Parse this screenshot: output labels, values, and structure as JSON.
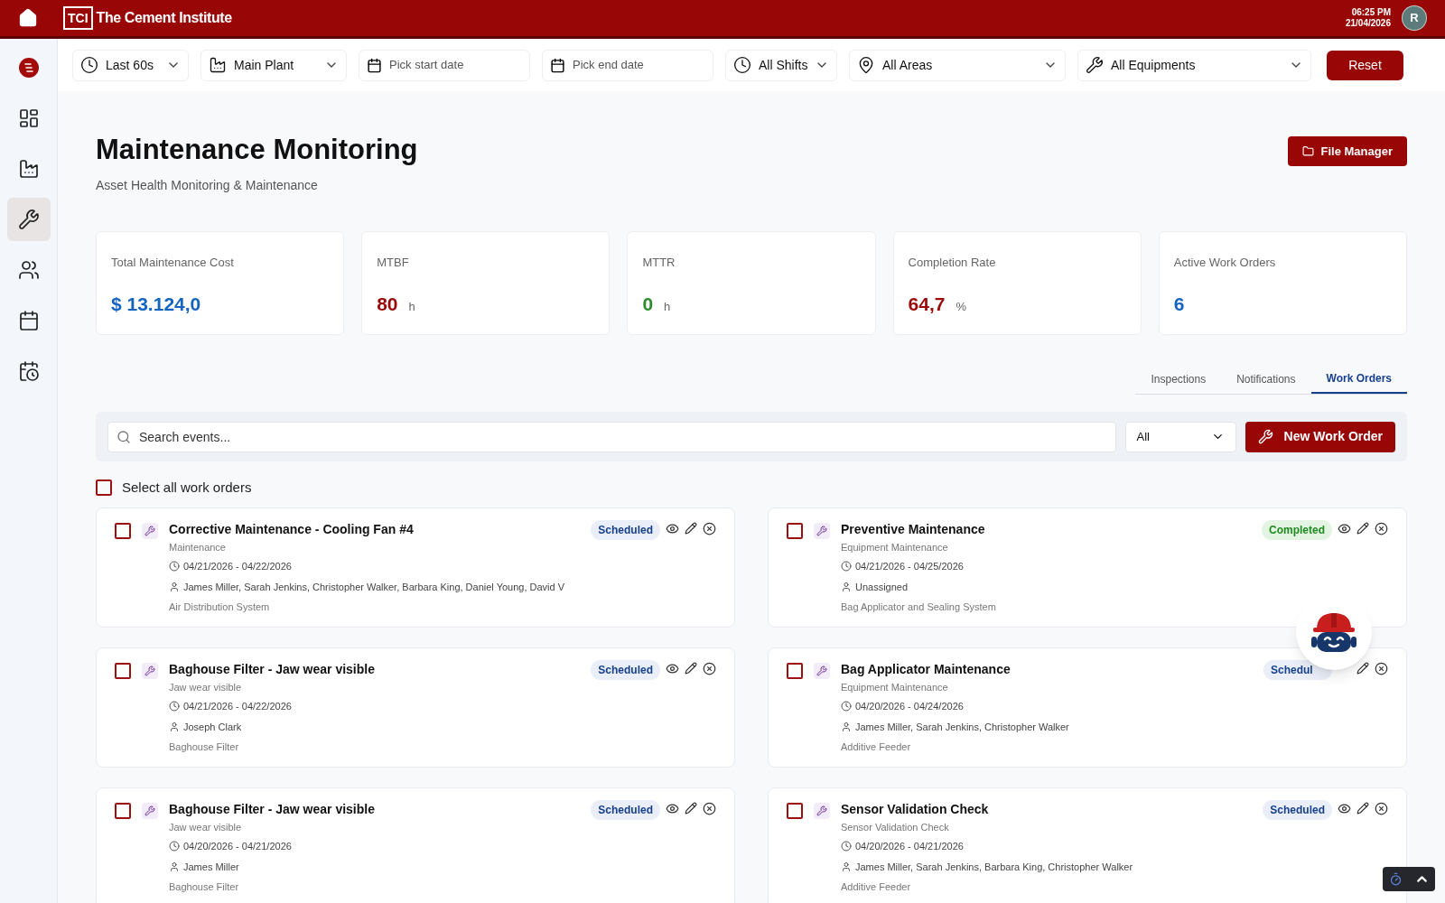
{
  "header": {
    "logo_mark": "TCI",
    "brand": "The Cement Institute",
    "time": "06:25 PM",
    "date": "21/04/2026",
    "avatar": "R"
  },
  "sidebar": {
    "items": [
      {
        "kind": "logo",
        "selected": false
      },
      {
        "kind": "dashboard",
        "selected": false
      },
      {
        "kind": "factory",
        "selected": false
      },
      {
        "kind": "wrench",
        "selected": true
      },
      {
        "kind": "users",
        "selected": false
      },
      {
        "kind": "calendar",
        "selected": false
      },
      {
        "kind": "schedule",
        "selected": false
      }
    ]
  },
  "filters": [
    {
      "kind": "time",
      "value": "Last 60s"
    },
    {
      "kind": "plant",
      "value": "Main Plant"
    },
    {
      "kind": "date",
      "placeholder": "Pick start date"
    },
    {
      "kind": "date",
      "placeholder": "Pick end date"
    },
    {
      "kind": "shift",
      "value": "All Shifts"
    },
    {
      "kind": "area",
      "value": "All Areas"
    },
    {
      "kind": "equipment",
      "value": "All Equipments"
    }
  ],
  "reset_button": "Reset",
  "page": {
    "title": "Maintenance Monitoring",
    "subtitle": "Asset Health Monitoring & Maintenance",
    "file_manager_button": "File Manager"
  },
  "kpis": [
    {
      "label": "Total Maintenance Cost",
      "value": "$ 13.124,0",
      "color": "#1565c0"
    },
    {
      "label": "MTBF",
      "value": "80",
      "unit": "h",
      "color": "#9b0a0a"
    },
    {
      "label": "MTTR",
      "value": "0",
      "unit": "h",
      "color": "#2e8b2e"
    },
    {
      "label": "Completion Rate",
      "value": "64,7",
      "unit": "%",
      "color": "#9b0a0a"
    },
    {
      "label": "Active Work Orders",
      "value": "6",
      "color": "#1565c0"
    }
  ],
  "tabs": [
    {
      "label": "Inspections",
      "selected": false
    },
    {
      "label": "Notifications",
      "selected": false
    },
    {
      "label": "Work Orders",
      "selected": true
    }
  ],
  "search": {
    "placeholder": "Search events..."
  },
  "status_filter": {
    "value": "All"
  },
  "new_button": "New Work Order",
  "select_all": {
    "label": "Select all work orders",
    "checked": false
  },
  "work_orders": [
    {
      "title": "Corrective Maintenance - Cooling Fan #4",
      "type": "Maintenance",
      "dates": "04/21/2026 - 04/22/2026",
      "assignees": "James Miller, Sarah Jenkins, Christopher Walker, Barbara King, Daniel Young, David V",
      "location": "Air Distribution System",
      "status": {
        "label": "Scheduled",
        "kind": "scheduled"
      },
      "checked": false
    },
    {
      "title": "Preventive Maintenance",
      "type": "Equipment Maintenance",
      "dates": "04/21/2026 - 04/25/2026",
      "assignees": "Unassigned",
      "location": "Bag Applicator and Sealing System",
      "status": {
        "label": "Completed",
        "kind": "completed"
      },
      "checked": false
    },
    {
      "title": "Baghouse Filter - Jaw wear visible",
      "type": "Jaw wear visible",
      "dates": "04/21/2026 - 04/22/2026",
      "assignees": "Joseph Clark",
      "location": "Baghouse Filter",
      "status": {
        "label": "Scheduled",
        "kind": "scheduled"
      },
      "checked": false
    },
    {
      "title": "Bag Applicator Maintenance",
      "type": "Equipment Maintenance",
      "dates": "04/20/2026 - 04/24/2026",
      "assignees": "James Miller, Sarah Jenkins, Christopher Walker",
      "location": "Additive Feeder",
      "status": {
        "label": "Schedul",
        "kind": "scheduled"
      },
      "checked": false
    },
    {
      "title": "Baghouse Filter - Jaw wear visible",
      "type": "Jaw wear visible",
      "dates": "04/20/2026 - 04/21/2026",
      "assignees": "James Miller",
      "location": "Baghouse Filter",
      "status": {
        "label": "Scheduled",
        "kind": "scheduled"
      },
      "checked": false
    },
    {
      "title": "Sensor Validation Check",
      "type": "Sensor Validation Check",
      "dates": "04/20/2026 - 04/21/2026",
      "assignees": "James Miller, Sarah Jenkins, Barbara King, Christopher Walker",
      "location": "Additive Feeder",
      "status": {
        "label": "Scheduled",
        "kind": "scheduled"
      },
      "checked": false
    }
  ]
}
